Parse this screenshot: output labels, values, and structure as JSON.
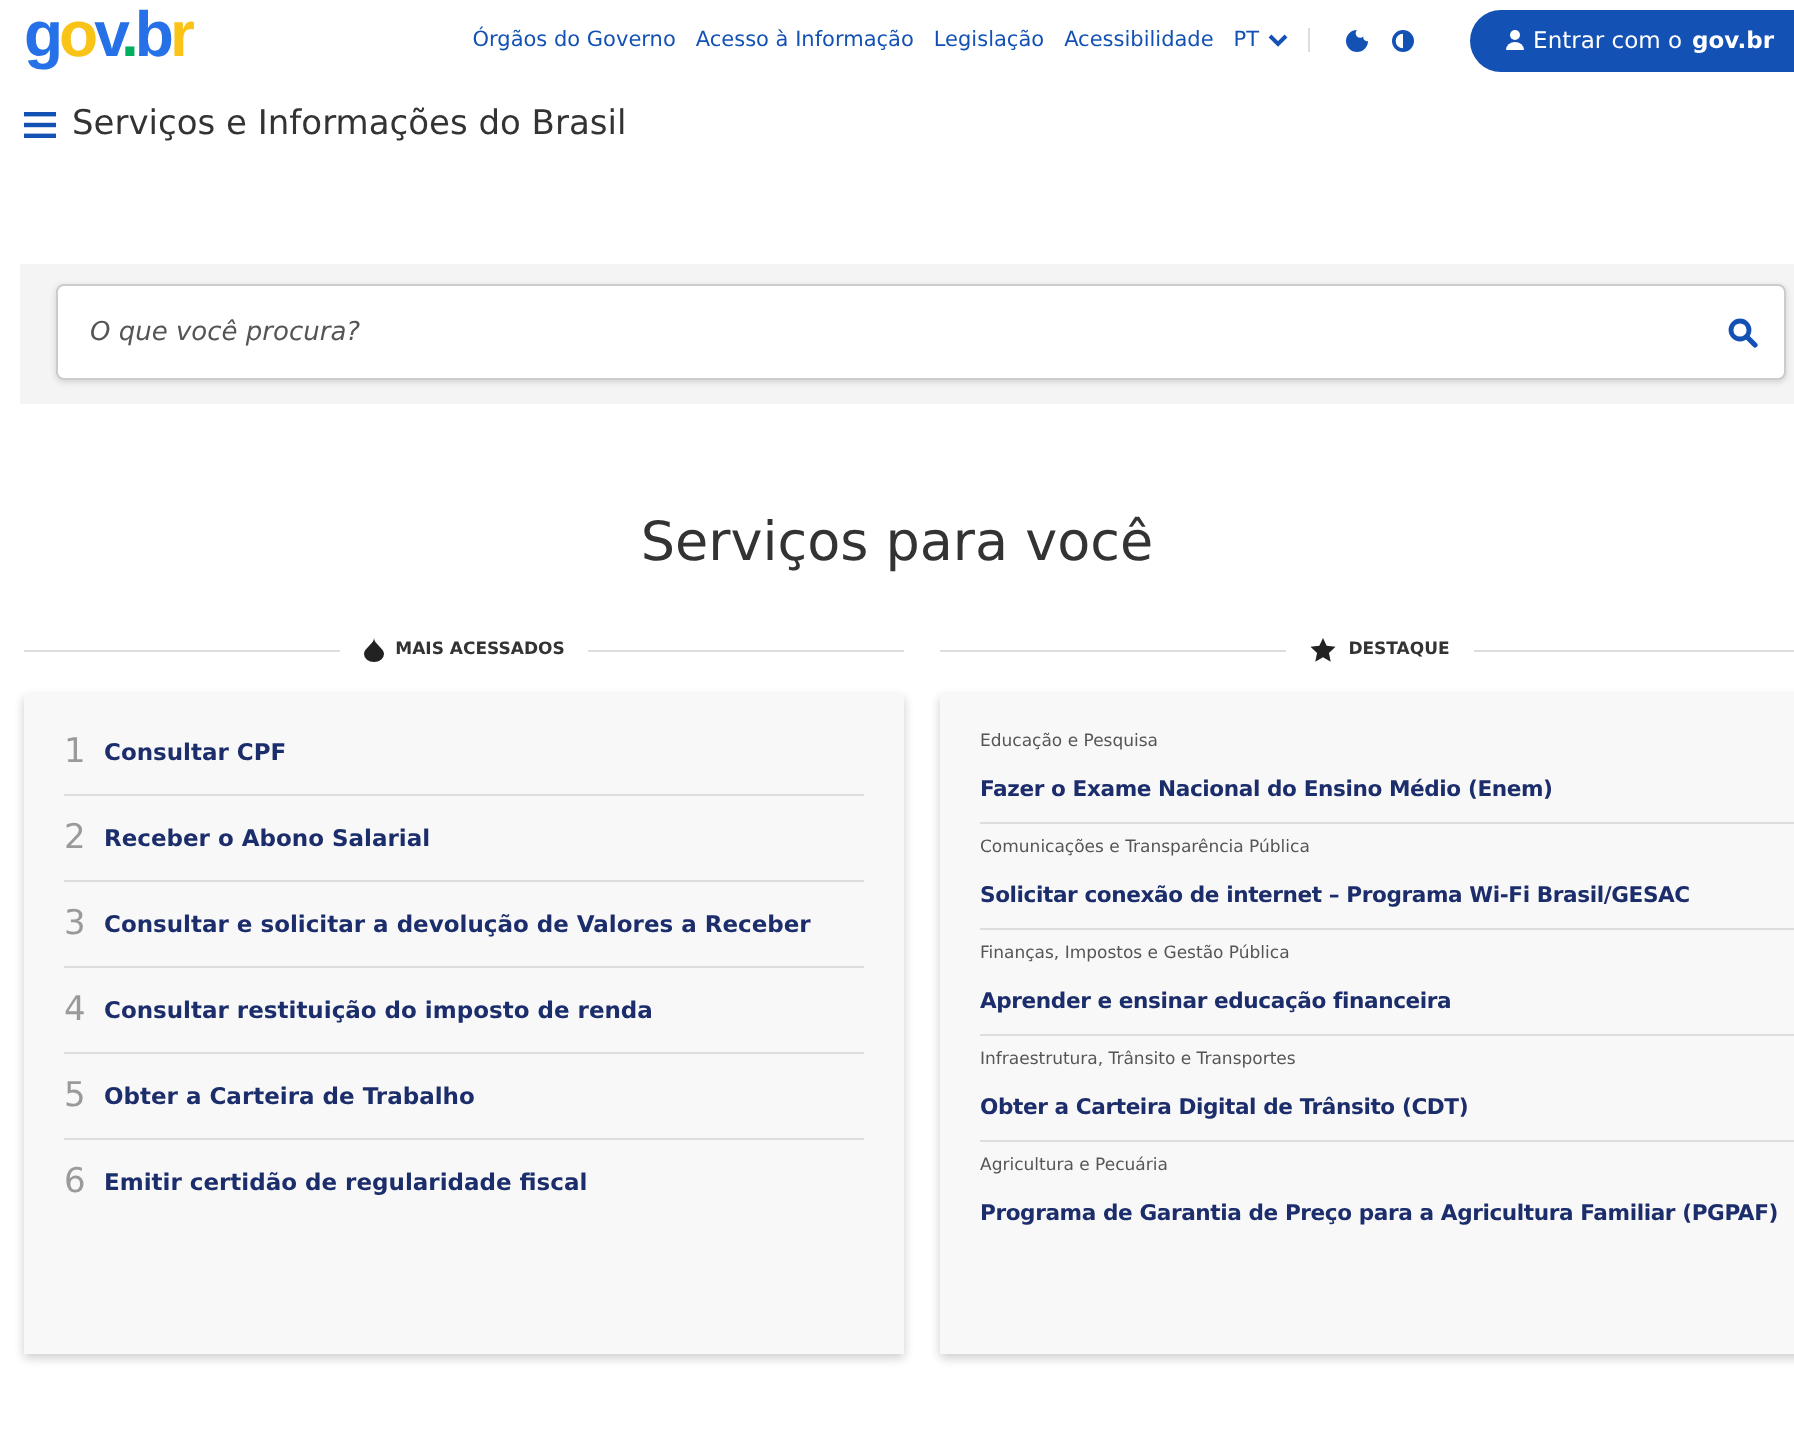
{
  "header": {
    "logo": {
      "parts": [
        {
          "text": "g",
          "color": "#2670e8"
        },
        {
          "text": "o",
          "color": "#f9c417"
        },
        {
          "text": "v",
          "color": "#2670e8"
        },
        {
          "text": ".",
          "color": "#00b060"
        },
        {
          "text": "b",
          "color": "#2670e8"
        },
        {
          "text": "r",
          "color": "#f9c417"
        }
      ]
    },
    "nav": [
      "Órgãos do Governo",
      "Acesso à Informação",
      "Legislação",
      "Acessibilidade"
    ],
    "language": "PT",
    "login": {
      "label": "Entrar com o ",
      "brand": "gov.br"
    }
  },
  "menu": {
    "title": "Serviços e Informações do Brasil"
  },
  "search": {
    "placeholder": "O que você procura?"
  },
  "section_title": "Serviços para você",
  "most_accessed": {
    "heading": "MAIS ACESSADOS",
    "items": [
      {
        "number": "1",
        "label": "Consultar CPF"
      },
      {
        "number": "2",
        "label": "Receber o Abono Salarial"
      },
      {
        "number": "3",
        "label": "Consultar e solicitar a devolução de Valores a Receber"
      },
      {
        "number": "4",
        "label": "Consultar restituição do imposto de renda"
      },
      {
        "number": "5",
        "label": "Obter a Carteira de Trabalho"
      },
      {
        "number": "6",
        "label": "Emitir certidão de regularidade fiscal"
      }
    ]
  },
  "highlights": {
    "heading": "DESTAQUE",
    "items": [
      {
        "category": "Educação e Pesquisa",
        "label": "Fazer o Exame Nacional do Ensino Médio (Enem)"
      },
      {
        "category": "Comunicações e Transparência Pública",
        "label": "Solicitar conexão de internet – Programa Wi-Fi Brasil/GESAC"
      },
      {
        "category": "Finanças, Impostos e Gestão Pública",
        "label": "Aprender e ensinar educação financeira"
      },
      {
        "category": "Infraestrutura, Trânsito e Transportes",
        "label": "Obter a Carteira Digital de Trânsito (CDT)"
      },
      {
        "category": "Agricultura e Pecuária",
        "label": "Programa de Garantia de Preço para a Agricultura Familiar (PGPAF)"
      }
    ]
  }
}
